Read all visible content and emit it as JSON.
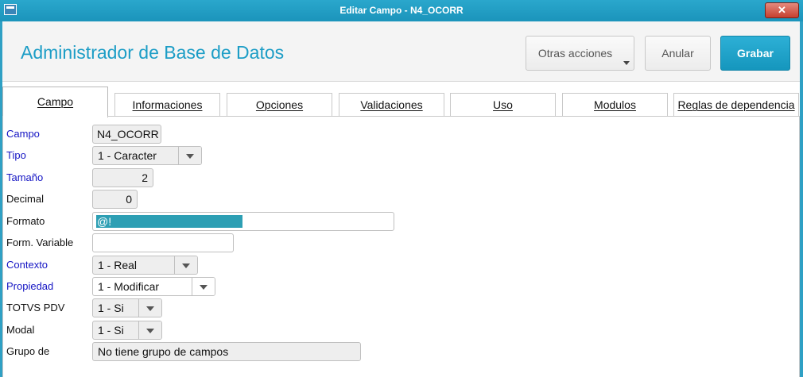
{
  "window": {
    "title": "Editar Campo - N4_OCORR",
    "close_symbol": "✕"
  },
  "header": {
    "title": "Administrador de Base de Datos",
    "buttons": {
      "more": "Otras acciones",
      "cancel": "Anular",
      "save": "Grabar"
    }
  },
  "tabs": [
    {
      "label": "Campo",
      "active": true
    },
    {
      "label": "Informaciones"
    },
    {
      "label": "Opciones"
    },
    {
      "label": "Validaciones"
    },
    {
      "label": "Uso"
    },
    {
      "label": "Modulos"
    },
    {
      "label": "Reglas de dependencia"
    }
  ],
  "form": {
    "campo": {
      "label": "Campo",
      "value": "N4_OCORR"
    },
    "tipo": {
      "label": "Tipo",
      "value": "1 - Caracter"
    },
    "tamano": {
      "label": "Tamaño",
      "value": "2"
    },
    "decimal": {
      "label": "Decimal",
      "value": "0"
    },
    "formato": {
      "label": "Formato",
      "value": "@!"
    },
    "form_variable": {
      "label": "Form. Variable",
      "value": ""
    },
    "contexto": {
      "label": "Contexto",
      "value": "1 - Real"
    },
    "propiedad": {
      "label": "Propiedad",
      "value": "1 - Modificar"
    },
    "totvs_pdv": {
      "label": "TOTVS PDV",
      "value": "1 - Si"
    },
    "modal": {
      "label": "Modal",
      "value": "1 - Si"
    },
    "grupo": {
      "label": "Grupo de",
      "value": "No tiene grupo de campos"
    }
  },
  "colors": {
    "accent": "#1c9dc6",
    "title_bar": "#1b94bb",
    "required_label": "#1515c4",
    "selection": "#2d9fb4"
  }
}
